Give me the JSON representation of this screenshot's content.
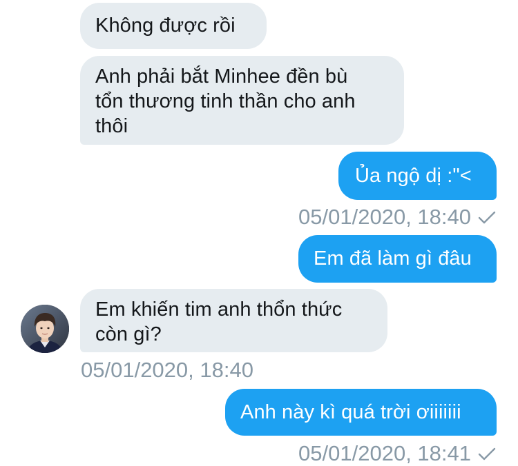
{
  "messages": [
    {
      "side": "in",
      "text": "Không được rồi"
    },
    {
      "side": "in",
      "lines": [
        "Anh phải bắt Minhee đền bù",
        "tổn thương tinh thần cho anh",
        "thôi"
      ]
    },
    {
      "side": "out",
      "text": "Ủa ngộ dị :\"<"
    },
    {
      "side": "out",
      "text": "Em đã làm gì đâu"
    },
    {
      "side": "in",
      "lines": [
        "Em khiến tim anh thổn thức",
        "còn gì?"
      ]
    },
    {
      "side": "out",
      "text": "Anh này kì quá trời ơiiiiiii"
    }
  ],
  "timestamps": {
    "sent_1": "05/01/2020, 18:40",
    "received_1": "05/01/2020, 18:40",
    "sent_2": "05/01/2020, 18:41"
  },
  "icons": {
    "read_receipt": "check-icon",
    "contact_avatar": "avatar"
  },
  "colors": {
    "outgoing_bubble": "#1da1f2",
    "incoming_bubble": "#e6ecf0",
    "timestamp": "#8899a6"
  }
}
